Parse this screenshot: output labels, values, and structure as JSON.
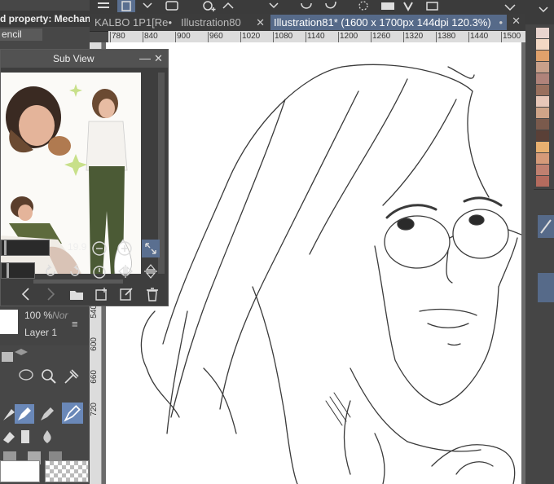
{
  "tool_property": {
    "title": "d property: Mechanica",
    "subtool": "encil"
  },
  "tabs": [
    {
      "label": "KALBO 1P1[Re",
      "active": false,
      "modified": true
    },
    {
      "label": "Illustration80",
      "active": false,
      "modified": false
    },
    {
      "label": "Illustration81* (1600 x 1700px 144dpi 120.3%)",
      "active": true,
      "modified": true
    }
  ],
  "ruler_top": [
    "780",
    "840",
    "900",
    "960",
    "1020",
    "1080",
    "1140",
    "1200",
    "1260",
    "1320",
    "1380",
    "1440",
    "1500"
  ],
  "ruler_left": [
    "540",
    "600",
    "660",
    "720"
  ],
  "subview": {
    "title": "Sub View",
    "zoom_value": "19.9"
  },
  "layer": {
    "opacity": "100 %",
    "blend": "Nor",
    "name": "Layer 1"
  },
  "palette_colors": [
    "#e9d5cf",
    "#f3d9c5",
    "#e0a16b",
    "#c8a08a",
    "#b0837a",
    "#99705e",
    "#e7c7b8",
    "#cfa488",
    "#7a5a4c",
    "#5a4037",
    "#e8b070",
    "#d59a79",
    "#c08070",
    "#b46b5e"
  ],
  "accent_color": "#566a89",
  "active_tool_color": "#6a88b8"
}
